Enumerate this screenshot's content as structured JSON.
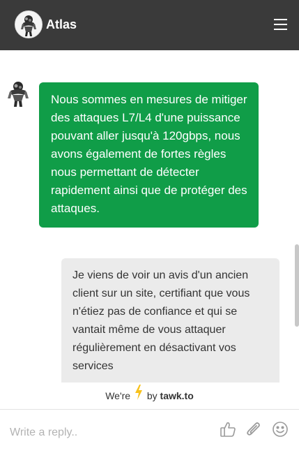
{
  "header": {
    "title": "Atlas",
    "logo_icon": "atlas-statue-logo-icon",
    "menu_icon": "hamburger-menu-icon",
    "background": "#3a3a3a"
  },
  "messages": [
    {
      "sender": "agent",
      "text": "Nous sommes en mesures de mitiger des attaques L7/L4 d'une puissance pouvant aller jusqu'à 120gbps, nous avons également de fortes règles nous permettant de détecter rapidement ainsi que de protéger des attaques.",
      "color": "#109d48"
    },
    {
      "sender": "visitor",
      "text": "Je viens de voir un avis d'un ancien client sur un site, certifiant que vous n'étiez pas de confiance et qui se vantait même de vous attaquer régulièrement en désactivant vos services",
      "color": "#ebebeb"
    }
  ],
  "branding": {
    "prefix": "We're",
    "by": "by",
    "brand": "tawk.to",
    "bolt_icon": "lightning-bolt-icon",
    "bolt_color": "#f8c21c"
  },
  "composer": {
    "placeholder": "Write a reply..",
    "value": "",
    "icons": [
      "thumbs-up-icon",
      "paperclip-icon",
      "smiley-icon"
    ]
  }
}
